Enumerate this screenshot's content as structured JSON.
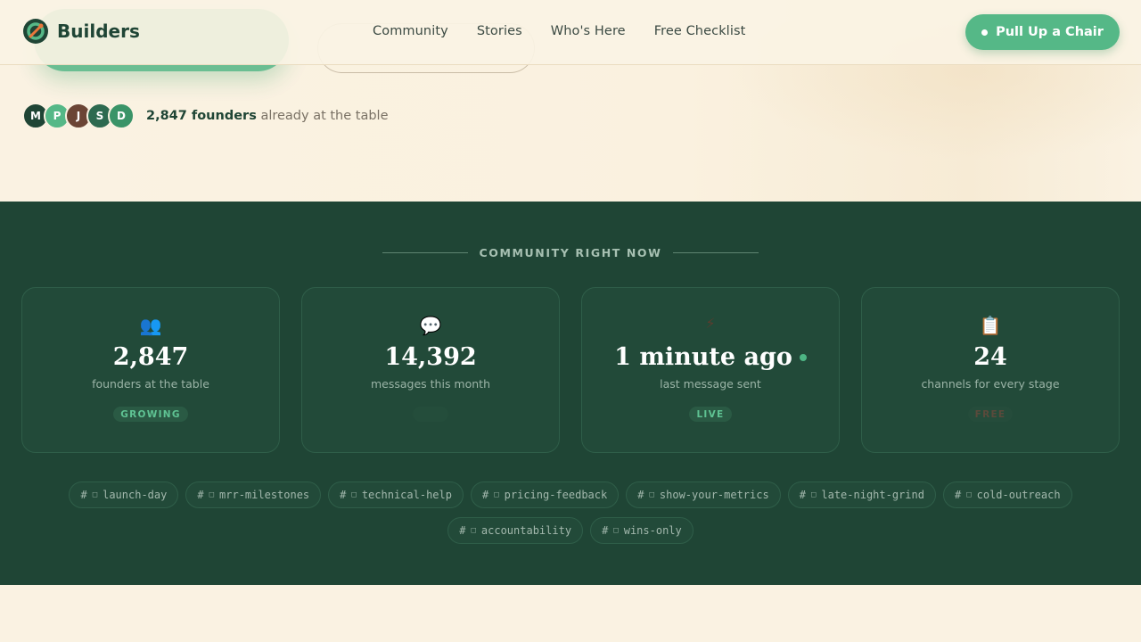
{
  "header": {
    "brand": "Builders",
    "nav": [
      "Community",
      "Stories",
      "Who's Here",
      "Free Checklist"
    ],
    "cta_label": "Pull Up a Chair"
  },
  "social_proof": {
    "avatars": [
      {
        "initial": "M",
        "color": "#1f4535"
      },
      {
        "initial": "P",
        "color": "#55b887"
      },
      {
        "initial": "J",
        "color": "#6b4535"
      },
      {
        "initial": "S",
        "color": "#2d6a50"
      },
      {
        "initial": "D",
        "color": "#3a9468"
      }
    ],
    "count_text": "2,847 founders",
    "suffix_text": "already at the table"
  },
  "community": {
    "section_title": "COMMUNITY RIGHT NOW",
    "stats": [
      {
        "icon": "people-icon",
        "glyph": "👥",
        "value": "2,847",
        "label": "founders at the table",
        "badge": "GROWING",
        "badge_style": "green",
        "live_dot": false
      },
      {
        "icon": "chat-icon",
        "glyph": "💬",
        "value": "14,392",
        "label": "messages this month",
        "badge": "",
        "badge_style": "faint",
        "live_dot": false
      },
      {
        "icon": "lightning-icon",
        "glyph": "⚡",
        "value": "1 minute ago",
        "label": "last message sent",
        "badge": "LIVE",
        "badge_style": "live",
        "live_dot": true
      },
      {
        "icon": "grid-icon",
        "glyph": "📋",
        "value": "24",
        "label": "channels for every stage",
        "badge": "FREE",
        "badge_style": "free",
        "live_dot": false
      }
    ],
    "channels": [
      "launch-day",
      "mrr-milestones",
      "technical-help",
      "pricing-feedback",
      "show-your-metrics",
      "late-night-grind",
      "cold-outreach",
      "accountability",
      "wins-only"
    ],
    "channel_prefix": "#",
    "channel_icon": "□"
  },
  "colors": {
    "accent": "#55b887",
    "dark_green": "#1f4535",
    "cream": "#faf2e2"
  }
}
